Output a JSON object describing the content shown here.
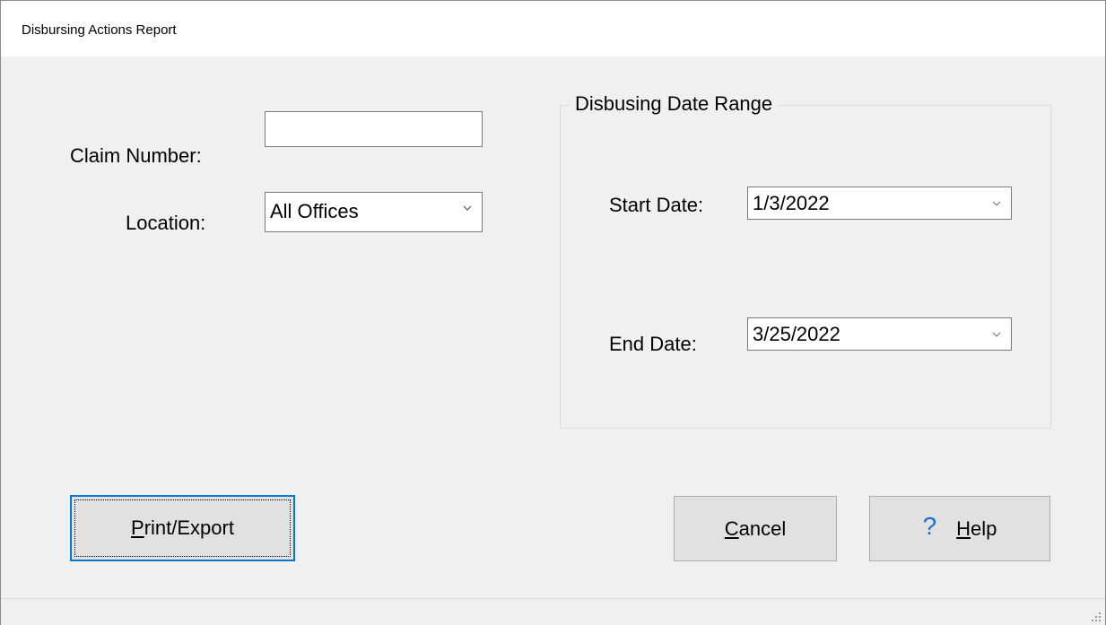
{
  "window": {
    "title": "Disbursing Actions Report"
  },
  "form": {
    "claim_number": {
      "label": "Claim Number:",
      "value": ""
    },
    "location": {
      "label": "Location:",
      "value": "All Offices"
    }
  },
  "date_range": {
    "title": "Disbusing Date Range",
    "start": {
      "label": "Start Date:",
      "value": "1/3/2022"
    },
    "end": {
      "label": "End Date:",
      "value": "3/25/2022"
    }
  },
  "buttons": {
    "print_export": {
      "mnemonic": "P",
      "rest": "rint/Export"
    },
    "cancel": {
      "mnemonic": "C",
      "rest": "ancel"
    },
    "help": {
      "icon": "question-mark-icon",
      "icon_glyph": "?",
      "mnemonic": "H",
      "rest": "elp"
    }
  },
  "colors": {
    "focus_border": "#0078d7",
    "help_icon": "#1e6fd0"
  }
}
